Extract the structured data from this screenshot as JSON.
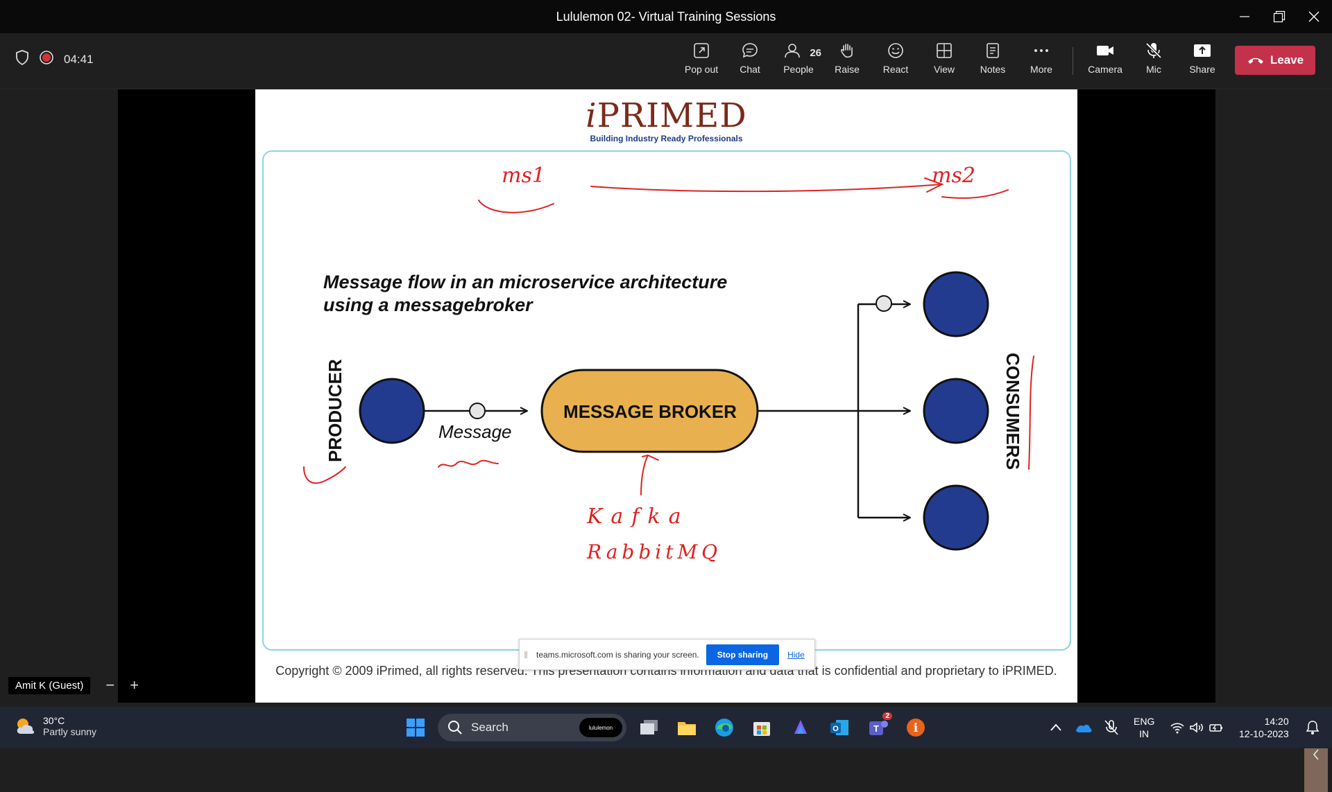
{
  "window": {
    "title": "Lululemon 02- Virtual Training Sessions"
  },
  "meeting": {
    "timer": "04:41"
  },
  "toolbar": {
    "pop_out": "Pop out",
    "chat": "Chat",
    "people": "People",
    "people_count": "26",
    "raise": "Raise",
    "react": "React",
    "view": "View",
    "notes": "Notes",
    "more": "More",
    "camera": "Camera",
    "mic": "Mic",
    "share": "Share",
    "leave": "Leave"
  },
  "slide": {
    "logo_i": "i",
    "logo_rest": "PRIMED",
    "logo_tagline": "Building Industry Ready Professionals",
    "heading_line1": "Message flow in an microservice architecture",
    "heading_line2": "using a messagebroker",
    "producer_label": "PRODUCER",
    "message_label": "Message",
    "broker_label": "MESSAGE BROKER",
    "consumers_label": "CONSUMERS",
    "copyright": "Copyright © 2009 iPrimed, all rights reserved. This presentation contains information  and data  that is confidential and proprietary to iPRIMED.",
    "annotation_ms1": "ms1",
    "annotation_ms2": "ms2",
    "annotation_kafka": "Kafka",
    "annotation_rabbitmq": "RabbitMQ"
  },
  "sharing_bar": {
    "message": "teams.microsoft.com is sharing your screen.",
    "stop": "Stop sharing",
    "hide": "Hide"
  },
  "participant": {
    "name": "Amit K (Guest)"
  },
  "taskbar": {
    "weather_temp": "30°C",
    "weather_desc": "Partly sunny",
    "search_label": "Search",
    "search_pill": "lululemon",
    "teams_badge": "2",
    "lang_line1": "ENG",
    "lang_line2": "IN",
    "time": "14:20",
    "date": "12-10-2023"
  },
  "colors": {
    "leave": "#c4314b",
    "broker_fill": "#e8b04f",
    "node_fill": "#1e3a8a",
    "annotation": "#e02020",
    "frame": "#8fd3e0",
    "stop_sharing": "#0b66e4"
  }
}
